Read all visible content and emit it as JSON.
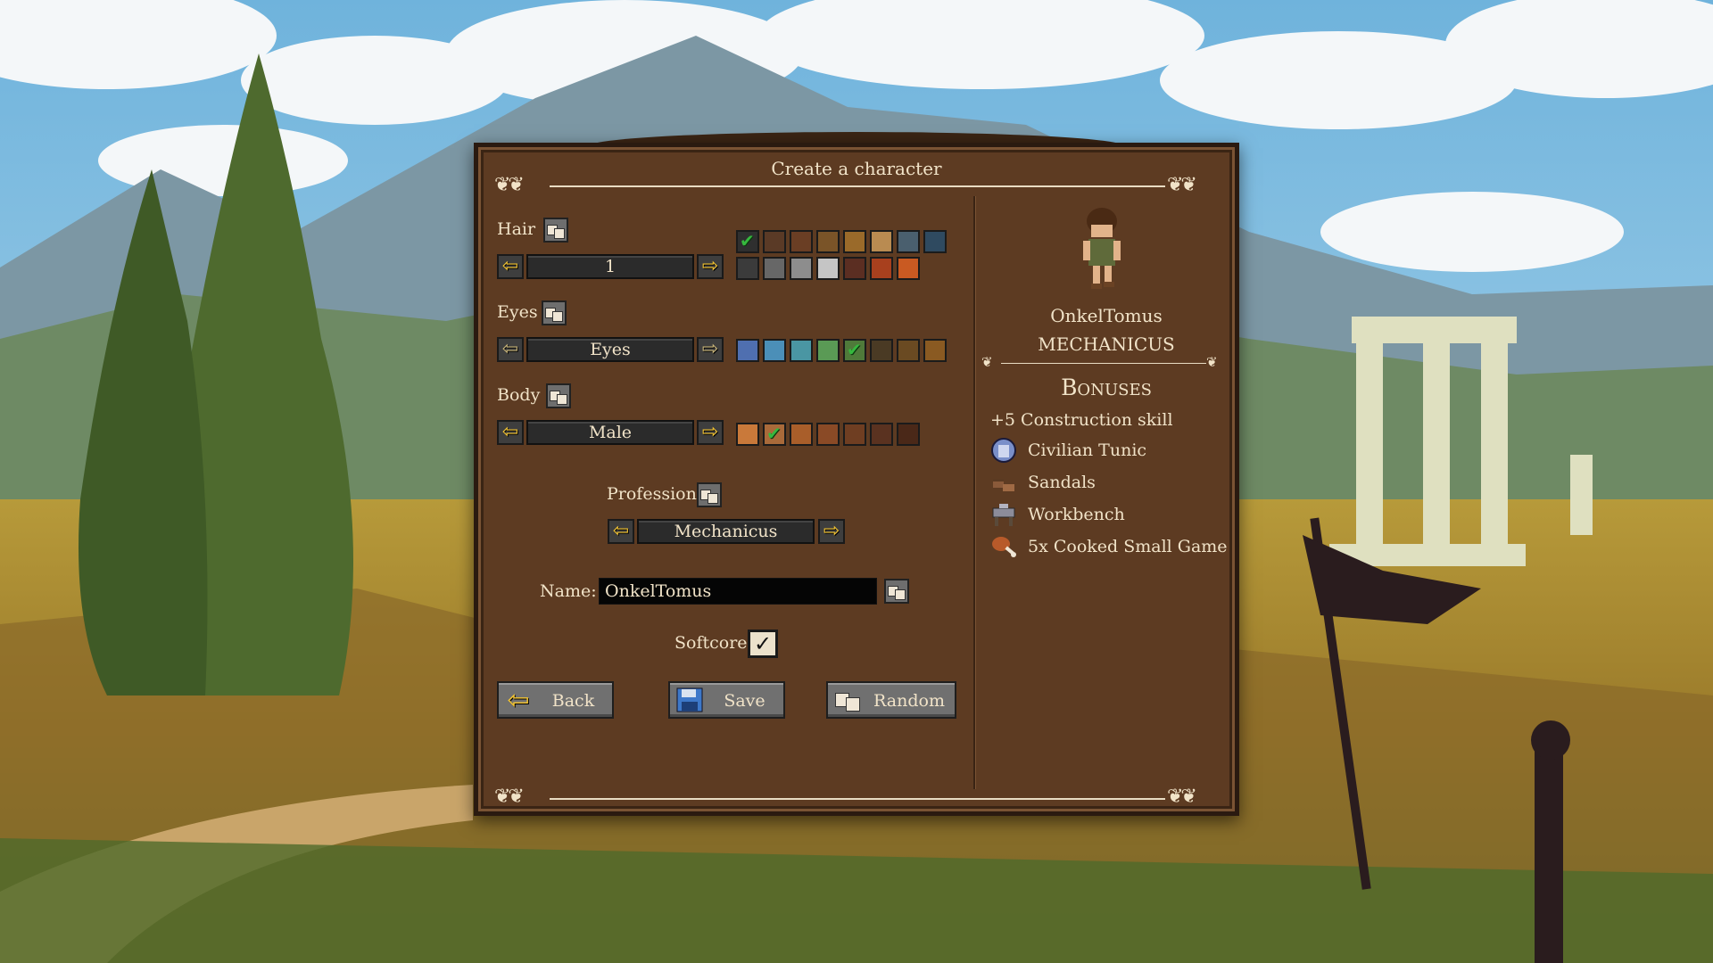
{
  "dialog": {
    "title": "Create a character"
  },
  "hair": {
    "label": "Hair",
    "value": "1",
    "colors": [
      "#2f2f2f",
      "#5a3a26",
      "#6a3e24",
      "#7a5428",
      "#9a6a2a",
      "#b98b51",
      "#4a5f6e",
      "#2f4a60",
      "#3b3b3b",
      "#676767",
      "#8d8d8d",
      "#c5c5c5",
      "#5b2e22",
      "#a8401e",
      "#c95a22"
    ],
    "selected_index": 0
  },
  "eyes": {
    "label": "Eyes",
    "value": "Eyes",
    "colors": [
      "#4f6fb0",
      "#4b8fb8",
      "#4a96a3",
      "#5a9a55",
      "#4f7a3a",
      "#4a3a24",
      "#6a4a22",
      "#8a5a22"
    ],
    "selected_index": 4
  },
  "body": {
    "label": "Body",
    "value": "Male",
    "colors": [
      "#c9793a",
      "#a96a3a",
      "#a95e2a",
      "#8a4a26",
      "#6f3e22",
      "#5a3220",
      "#4a2818"
    ],
    "selected_index": 1
  },
  "profession": {
    "label": "Profession",
    "value": "Mechanicus"
  },
  "name": {
    "label": "Name:",
    "value": "OnkelTomus"
  },
  "softcore": {
    "label": "Softcore",
    "checked": true
  },
  "buttons": {
    "back": "Back",
    "save": "Save",
    "random": "Random"
  },
  "preview": {
    "character_name": "OnkelTomus",
    "profession_title": "MECHANICUS",
    "bonuses_heading": "Bonuses",
    "skill_bonus": "+5 Construction skill",
    "items": [
      {
        "icon": "tunic-icon",
        "label": "Civilian Tunic"
      },
      {
        "icon": "sandals-icon",
        "label": "Sandals"
      },
      {
        "icon": "workbench-icon",
        "label": "Workbench"
      },
      {
        "icon": "meat-icon",
        "label": "5x Cooked Small Game"
      }
    ]
  },
  "colors": {
    "panel": "#5d3b22",
    "text": "#f1e3c8",
    "arrow": "#f3c433",
    "check": "#36b83e"
  }
}
